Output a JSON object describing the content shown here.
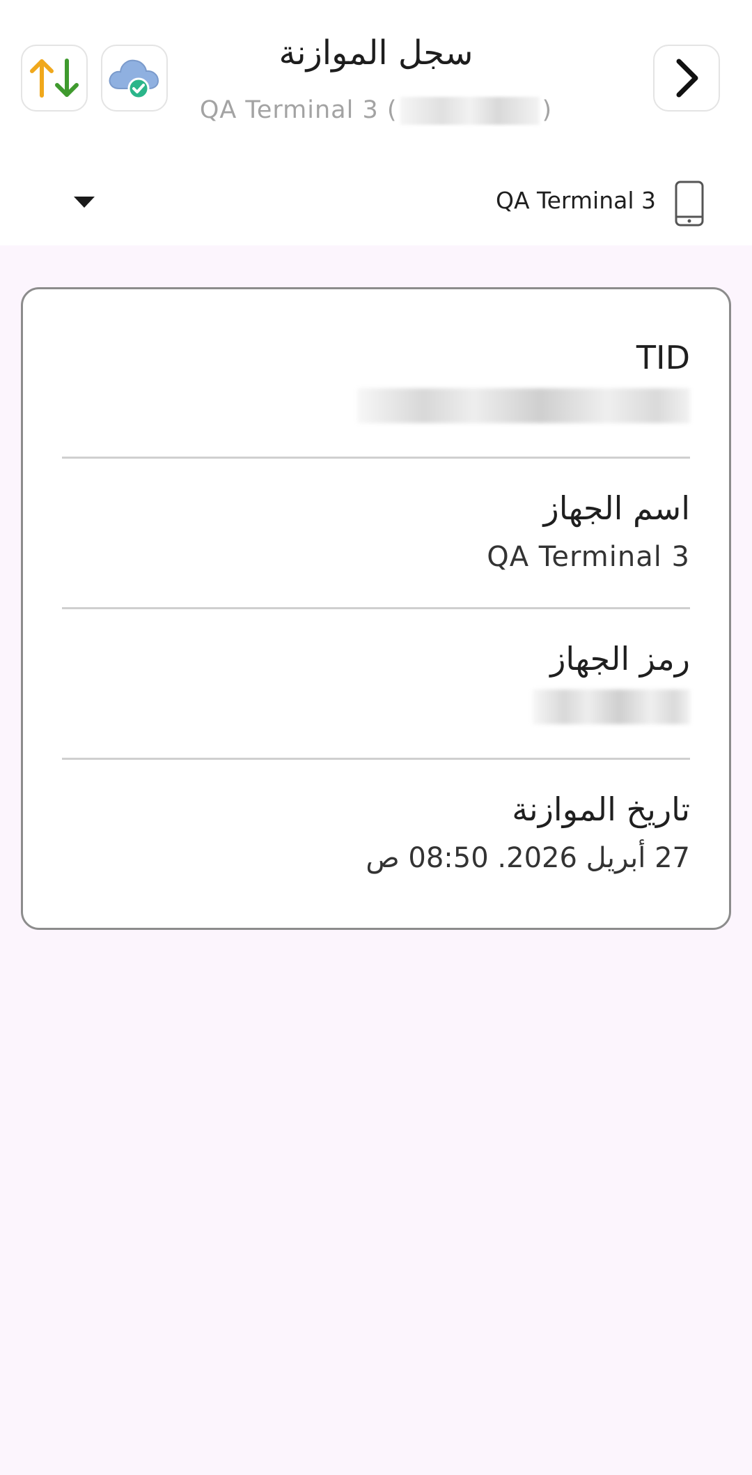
{
  "header": {
    "title": "سجل الموازنة",
    "subtitle": "QA Terminal 3 (",
    "subtitle_end": ")"
  },
  "terminal_selector": {
    "name": "QA Terminal 3"
  },
  "details": {
    "tid_label": "TID",
    "device_name_label": "اسم الجهاز",
    "device_name_value": "QA Terminal 3",
    "device_code_label": "رمز الجهاز",
    "reconciliation_date_label": "تاريخ الموازنة",
    "reconciliation_date_value": "27 أبريل 2026. 08:50 ص"
  },
  "colors": {
    "background": "#fcf5fd",
    "sync_up": "#f0a81c",
    "sync_down": "#3f9a2e",
    "cloud": "#8fb0e0",
    "check_badge": "#2bb58a"
  },
  "icons": {
    "sync": "up-down-arrows-icon",
    "cloud": "cloud-check-icon",
    "forward": "chevron-right-icon",
    "device": "phone-icon",
    "dropdown": "caret-down-icon"
  }
}
